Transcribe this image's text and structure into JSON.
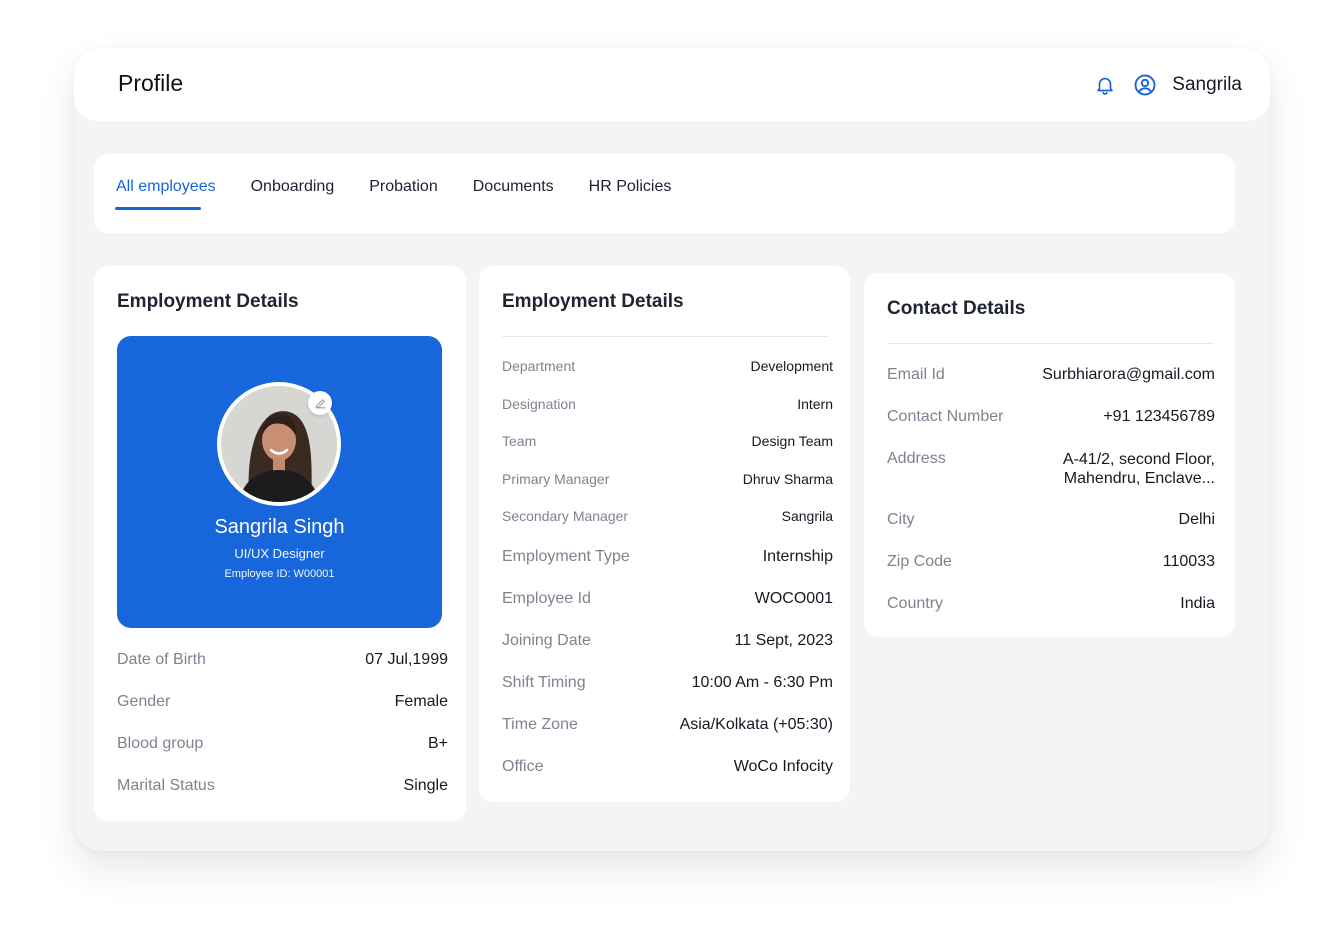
{
  "header": {
    "title": "Profile",
    "user_name": "Sangrila"
  },
  "tabs": [
    {
      "label": "All employees",
      "active": true
    },
    {
      "label": "Onboarding",
      "active": false
    },
    {
      "label": "Probation",
      "active": false
    },
    {
      "label": "Documents",
      "active": false
    },
    {
      "label": "HR Policies",
      "active": false
    }
  ],
  "profile_card": {
    "title": "Employment Details",
    "name": "Sangrila Singh",
    "role": "UI/UX Designer",
    "employee_id": "Employee ID: W00001",
    "rows": [
      {
        "label": "Date of Birth",
        "value": "07 Jul,1999"
      },
      {
        "label": "Gender",
        "value": "Female"
      },
      {
        "label": "Blood group",
        "value": "B+"
      },
      {
        "label": "Marital Status",
        "value": "Single"
      }
    ]
  },
  "employment_card": {
    "title": "Employment Details",
    "rows": [
      {
        "label": "Department",
        "value": "Development"
      },
      {
        "label": "Designation",
        "value": "Intern"
      },
      {
        "label": "Team",
        "value": "Design Team"
      },
      {
        "label": "Primary Manager",
        "value": "Dhruv Sharma"
      },
      {
        "label": "Secondary Manager",
        "value": "Sangrila"
      },
      {
        "label": "Employment Type",
        "value": "Internship"
      },
      {
        "label": "Employee Id",
        "value": "WOCO001"
      },
      {
        "label": "Joining Date",
        "value": "11 Sept, 2023"
      },
      {
        "label": "Shift Timing",
        "value": "10:00 Am - 6:30 Pm"
      },
      {
        "label": "Time Zone",
        "value": "Asia/Kolkata (+05:30)"
      },
      {
        "label": "Office",
        "value": "WoCo Infocity"
      }
    ]
  },
  "contact_card": {
    "title": "Contact Details",
    "rows": [
      {
        "label": "Email Id",
        "value": "Surbhiarora@gmail.com"
      },
      {
        "label": "Contact Number",
        "value": "+91 123456789"
      },
      {
        "label": "Address",
        "value_line1": "A-41/2, second Floor,",
        "value_line2": "Mahendru, Enclave..."
      },
      {
        "label": "City",
        "value": "Delhi"
      },
      {
        "label": "Zip Code",
        "value": "110033"
      },
      {
        "label": "Country",
        "value": "India"
      }
    ]
  },
  "colors": {
    "accent": "#1565d8",
    "card_blue": "#1766dc",
    "label_gray": "#7d8490",
    "background": "#f3f4f6"
  },
  "icons": {
    "notifications": "bell-icon",
    "account": "user-circle-icon",
    "edit": "pencil-icon"
  }
}
